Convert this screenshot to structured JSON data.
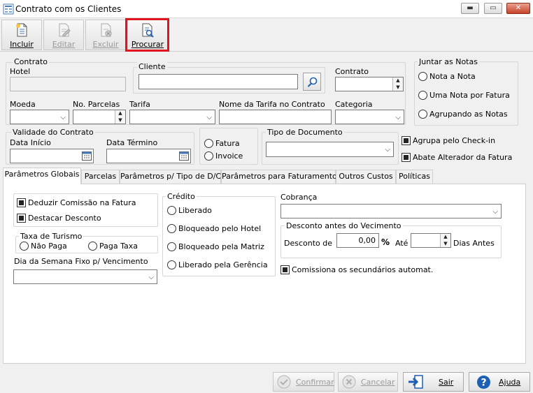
{
  "window": {
    "title": "Contrato com os Clientes",
    "controls": {
      "minimize": "▬",
      "maximize": "▭",
      "close": "✕"
    }
  },
  "toolbar": {
    "incluir": "Incluir",
    "editar": "Editar",
    "excluir": "Excluir",
    "procurar": "Procurar"
  },
  "contrato_group": {
    "legend": "Contrato",
    "hotel_label": "Hotel",
    "cliente_legend": "Cliente",
    "cliente_value": "",
    "contrato_label": "Contrato",
    "contrato_value": ""
  },
  "fields": {
    "moeda_label": "Moeda",
    "parcelas_label": "No. Parcelas",
    "tarifa_label": "Tarifa",
    "nome_tarifa_label": "Nome da Tarifa no Contrato",
    "categoria_label": "Categoria"
  },
  "validade": {
    "legend": "Validade do Contrato",
    "inicio_label": "Data Início",
    "termino_label": "Data Término"
  },
  "fatura_invoice": {
    "fatura": "Fatura",
    "invoice": "Invoice"
  },
  "tipo_documento": {
    "legend": "Tipo de Documento"
  },
  "juntar_notas": {
    "legend": "Juntar as Notas",
    "options": [
      "Nota a Nota",
      "Uma Nota por Fatura",
      "Agrupando as Notas"
    ]
  },
  "checks_top": {
    "checkin": "Agrupa pelo Check-in",
    "abate": "Abate Alterador da Fatura"
  },
  "tabs": [
    "Parâmetros Globais",
    "Parcelas",
    "Parâmetros p/ Tipo de D/C",
    "Parâmetros para Faturamento",
    "Outros Custos",
    "Políticas"
  ],
  "panel": {
    "deduzir": "Deduzir Comissão na Fatura",
    "destacar": "Destacar Desconto",
    "taxa_legend": "Taxa de Turismo",
    "nao_paga": "Não Paga",
    "paga_taxa": "Paga Taxa",
    "dia_semana": "Dia da Semana Fixo p/ Vencimento",
    "credito_legend": "Crédito",
    "credito_options": [
      "Liberado",
      "Bloqueado pelo Hotel",
      "Bloqueado pela Matriz",
      "Liberado pela Gerência"
    ],
    "cobranca": "Cobrança",
    "desconto_legend": "Desconto antes do Vecimento",
    "desconto_de": "Desconto de",
    "desconto_value": "0,00",
    "percent": "%",
    "ate": "Até",
    "dias_antes": "Dias Antes",
    "comissiona": "Comissiona os secundários automat."
  },
  "bottom": {
    "confirmar": "Confirmar",
    "cancelar": "Cancelar",
    "sair": "Sair",
    "ajuda": "Ajuda"
  },
  "colors": {
    "highlight": "#e0131f",
    "accent": "#1e5fb4"
  }
}
